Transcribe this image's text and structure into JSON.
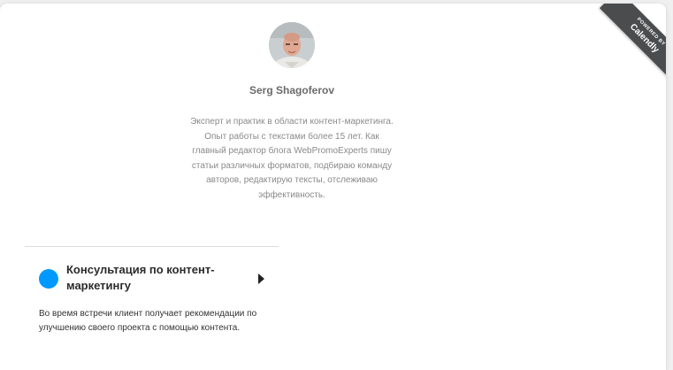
{
  "profile": {
    "name": "Serg Shagoferov",
    "bio": "Эксперт и практик в области контент-маркетинга. Опыт работы с текстами более 15 лет. Как главный редактор блога WebPromoExperts пишу статьи различных форматов, подбираю команду авторов, редактирую тексты, отслеживаю эффективность."
  },
  "event": {
    "title": "Консультация по контент-маркетингу",
    "description": "Во время встречи клиент получает рекомендации по улучшению своего проекта с помощью контента.",
    "color": "#0099ff"
  },
  "badge": {
    "small_text": "POWERED BY",
    "brand": "Calendly"
  }
}
